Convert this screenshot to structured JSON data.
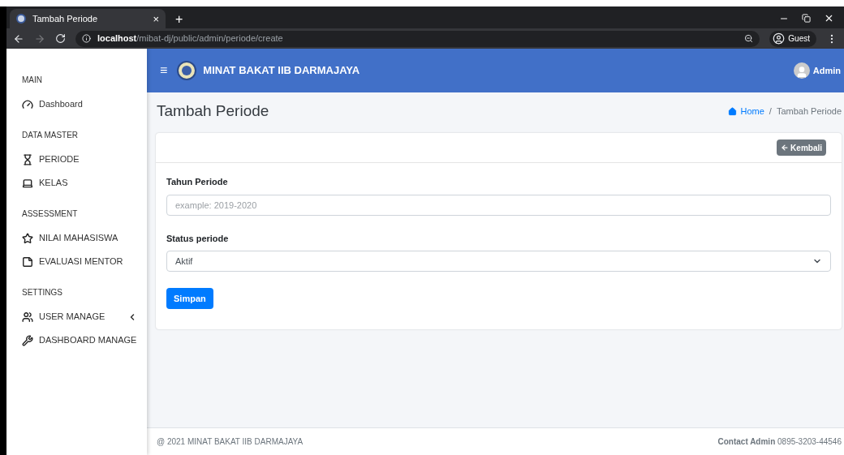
{
  "browser": {
    "tab_title": "Tambah Periode",
    "tab_close": "×",
    "new_tab": "+",
    "url_host": "localhost",
    "url_path": "/mibat-dj/public/admin/periode/create",
    "profile": "Guest"
  },
  "sidebar": {
    "sections": [
      {
        "heading": "MAIN",
        "items": [
          {
            "label": "Dashboard",
            "has_submenu": false
          }
        ]
      },
      {
        "heading": "DATA MASTER",
        "items": [
          {
            "label": "PERIODE",
            "has_submenu": false
          },
          {
            "label": "KELAS",
            "has_submenu": false
          }
        ]
      },
      {
        "heading": "ASSESSMENT",
        "items": [
          {
            "label": "NILAI MAHASISWA",
            "has_submenu": false
          },
          {
            "label": "EVALUASI MENTOR",
            "has_submenu": false
          }
        ]
      },
      {
        "heading": "SETTINGS",
        "items": [
          {
            "label": "USER MANAGE",
            "has_submenu": true
          },
          {
            "label": "DASHBOARD MANAGE",
            "has_submenu": false
          }
        ]
      }
    ]
  },
  "navbar": {
    "menu": "≡",
    "brand": "MINAT BAKAT IIB DARMAJAYA",
    "user": "Admin"
  },
  "page": {
    "title": "Tambah Periode",
    "breadcrumb": [
      {
        "label": "Home",
        "link": true
      },
      {
        "label": "Tambah Periode",
        "link": false
      }
    ],
    "breadcrumb_separator": "/"
  },
  "card": {
    "back_button": "Kembali",
    "fields": [
      {
        "kind": "text",
        "label": "Tahun Periode",
        "placeholder": "example: 2019-2020"
      },
      {
        "kind": "select",
        "label": "Status periode",
        "value": "Aktif"
      }
    ],
    "submit": "Simpan"
  },
  "footer": {
    "left": "@ 2021 MINAT BAKAT IIB DARMAJAYA",
    "right": "**Contact Admin** 0895-3203-44546"
  }
}
